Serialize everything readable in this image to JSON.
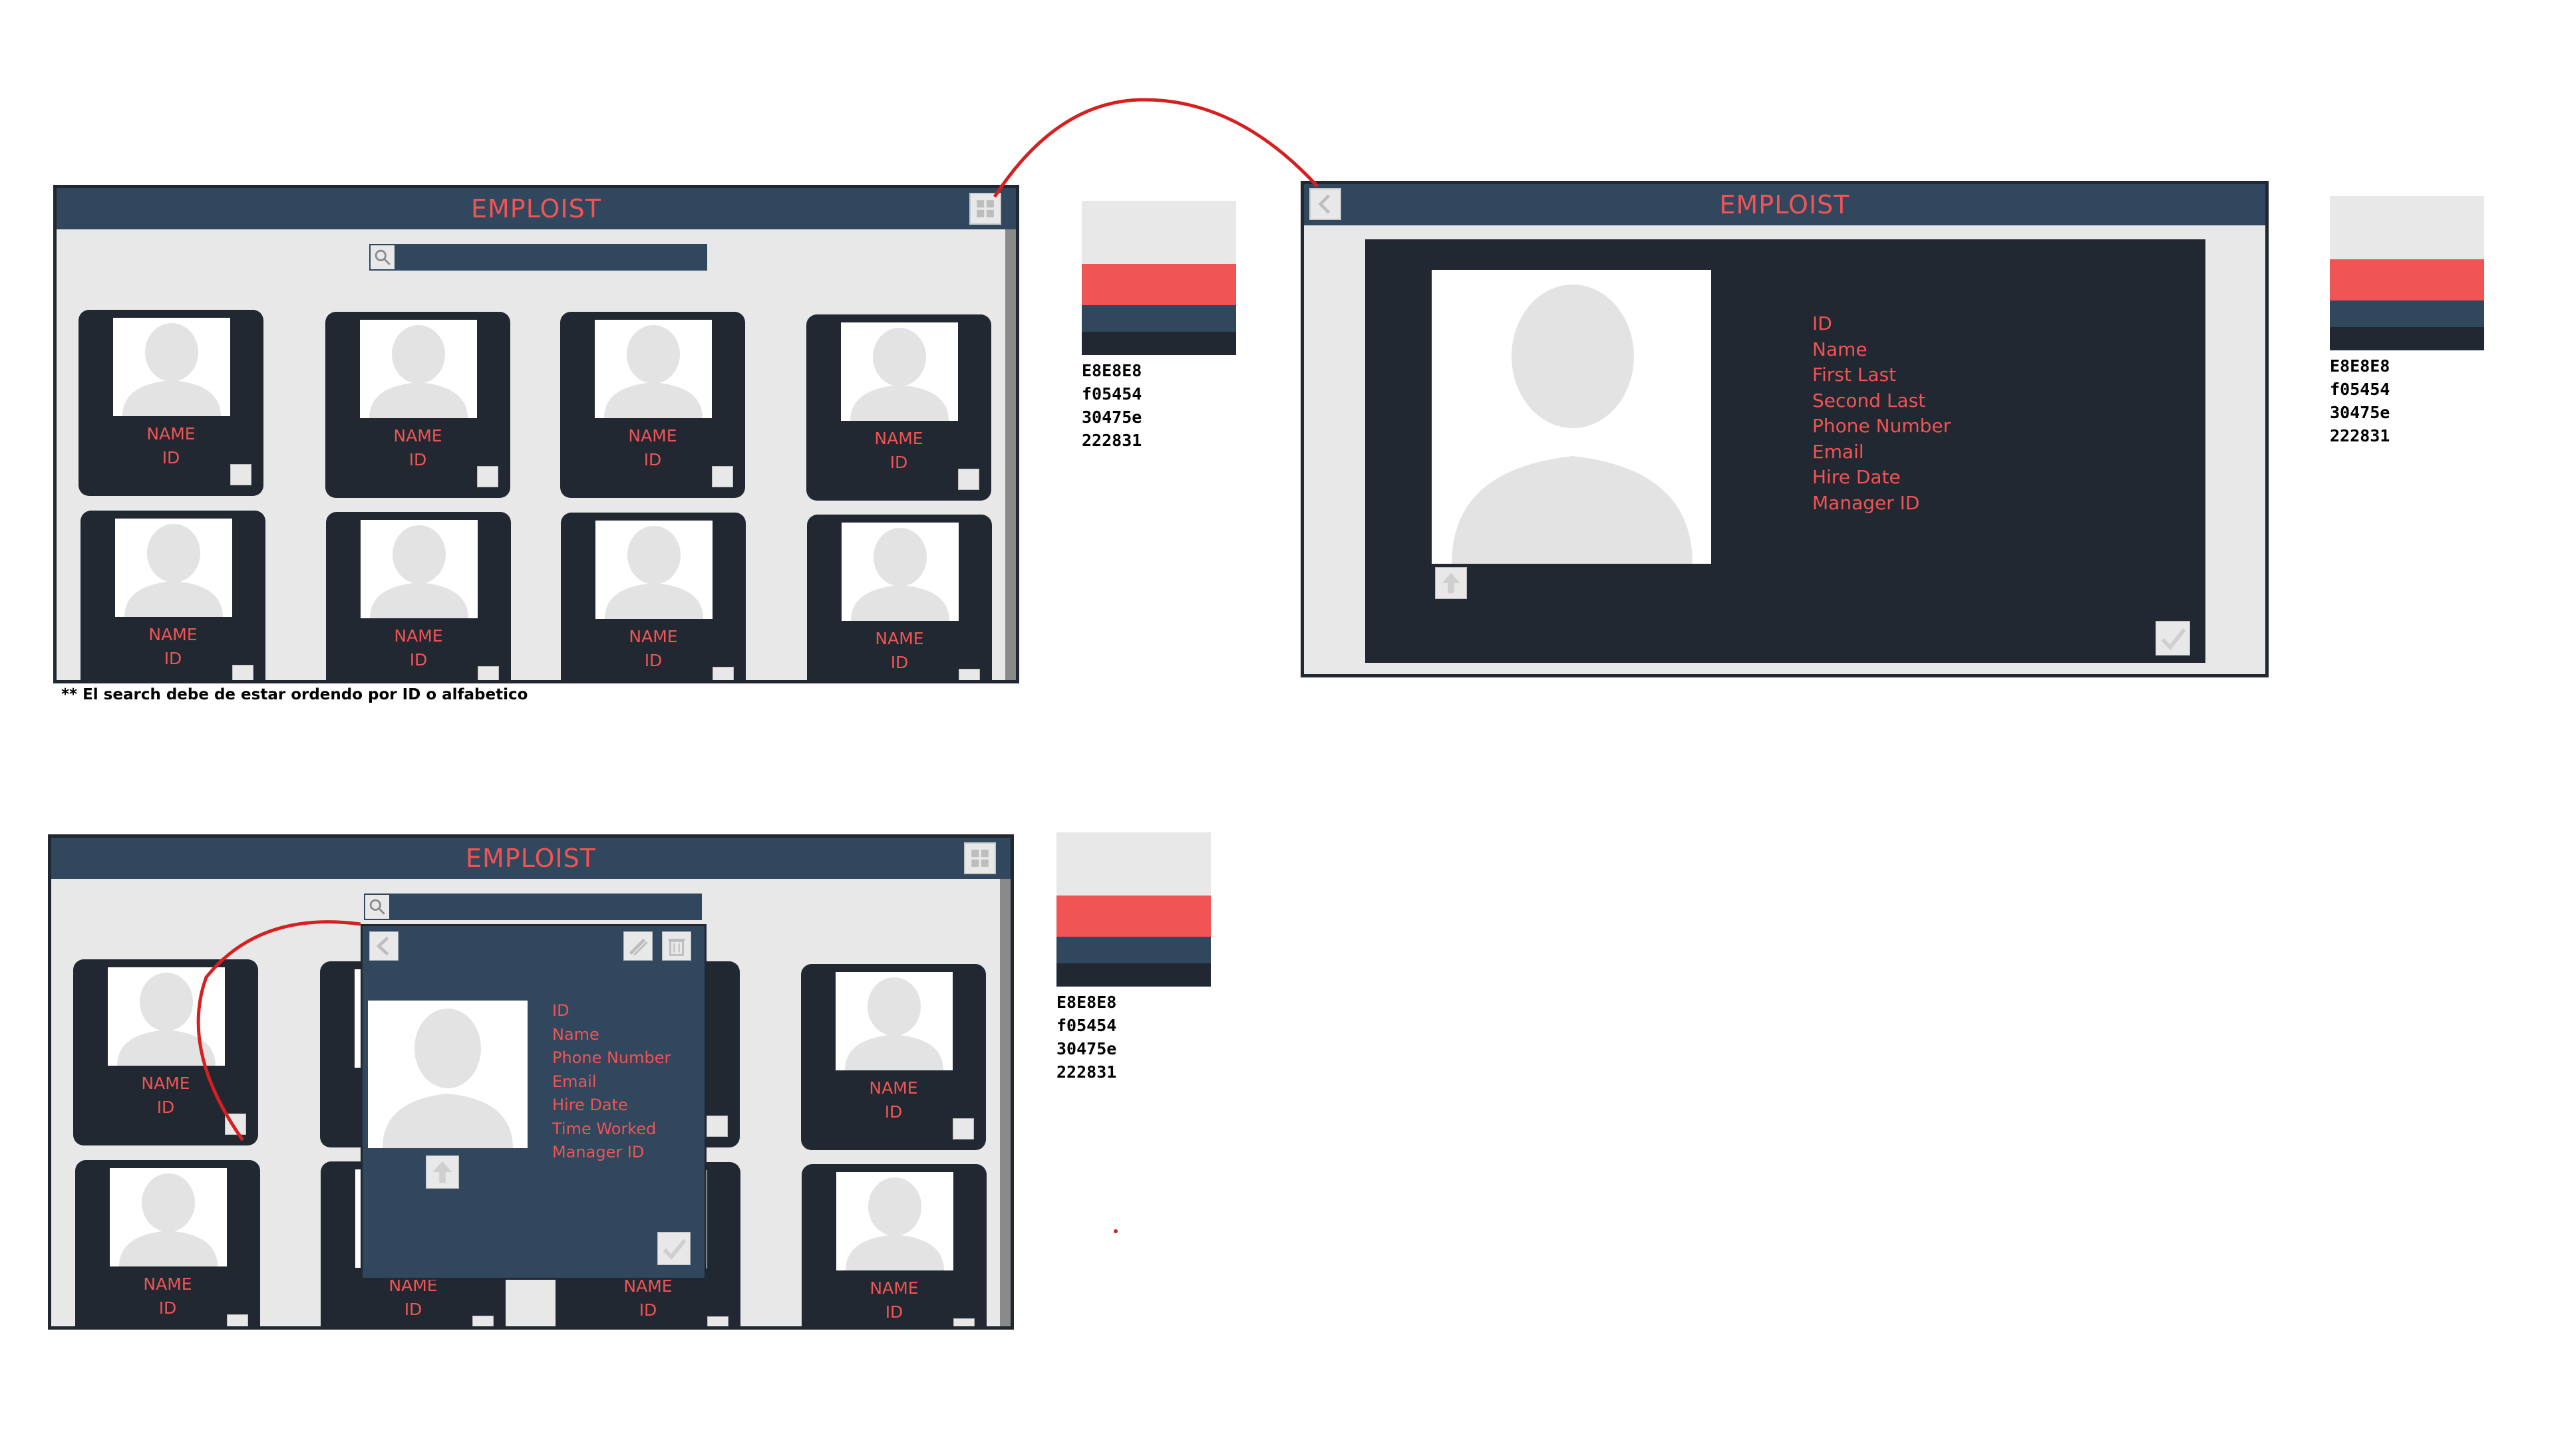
{
  "app": {
    "title": "EMPLOIST"
  },
  "card": {
    "name_label": "NAME",
    "id_label": "ID"
  },
  "note": "** El search debe de estar ordendo por ID o alfabetico",
  "palette": {
    "colors": [
      "#E8E8E8",
      "#f05454",
      "#30475e",
      "#222831"
    ],
    "codes": [
      "E8E8E8",
      "f05454",
      "30475e",
      "222831"
    ]
  },
  "detail_view": {
    "fields": [
      "ID",
      "Name",
      "First Last",
      "Second Last",
      "Phone Number",
      "Email",
      "Hire Date",
      "Manager ID"
    ]
  },
  "popup": {
    "fields": [
      "ID",
      "Name",
      "Phone Number",
      "Email",
      "Hire Date",
      "Time Worked",
      "Manager ID"
    ]
  },
  "icons": {
    "add": "add-user-icon",
    "back": "back-arrow-icon",
    "search": "search-icon",
    "upload": "upload-arrow-icon",
    "confirm": "checkmark-icon",
    "edit": "pencil-icon",
    "delete": "trash-icon",
    "avatar": "person-silhouette-icon"
  }
}
